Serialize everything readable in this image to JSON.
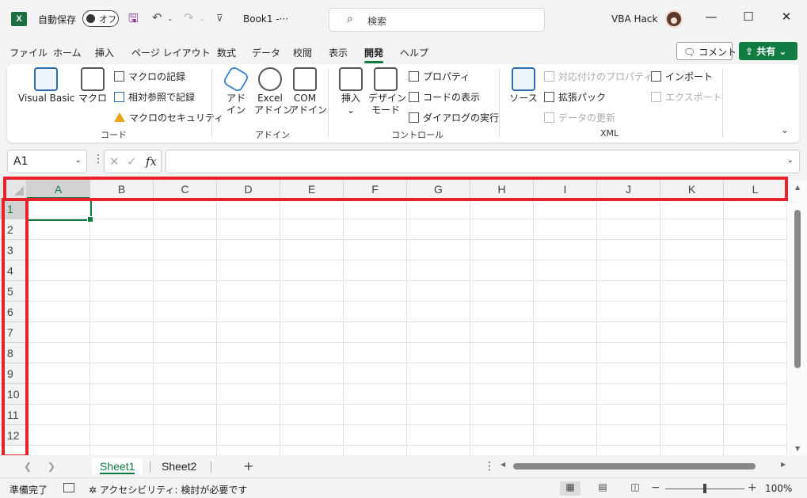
{
  "titlebar": {
    "app_logo": "X",
    "autosave_label": "自動保存",
    "autosave_state": "オフ",
    "document_title": "Book1  -···",
    "search_placeholder": "検索",
    "username": "VBA Hack",
    "icons": [
      "save-icon",
      "undo-icon",
      "redo-icon",
      "customize-qat-icon",
      "search-icon",
      "minimize-icon",
      "maximize-icon",
      "close-icon"
    ]
  },
  "menu": {
    "tabs": [
      "ファイル",
      "ホーム",
      "挿入",
      "ページ レイアウト",
      "数式",
      "データ",
      "校閲",
      "表示",
      "開発",
      "ヘルプ"
    ],
    "active_tab": "開発",
    "comment_label": "コメント",
    "share_label": "共有"
  },
  "ribbon": {
    "groups": [
      {
        "label": "コード",
        "big": [
          "Visual Basic",
          "マクロ"
        ],
        "small": [
          "マクロの記録",
          "相対参照で記録",
          "マクロのセキュリティ"
        ]
      },
      {
        "label": "アドイン",
        "big": [
          [
            "アド",
            "イン"
          ],
          [
            "Excel",
            "アドイン"
          ],
          [
            "COM",
            "アドイン"
          ]
        ]
      },
      {
        "label": "コントロール",
        "big": [
          [
            "挿入",
            "⌄"
          ],
          [
            "デザイン",
            "モード"
          ]
        ],
        "small": [
          "プロパティ",
          "コードの表示",
          "ダイアログの実行"
        ]
      },
      {
        "label": "XML",
        "big": [
          "ソース"
        ],
        "small": [
          "対応付けのプロパティ",
          "拡張パック",
          "データの更新",
          "インポート",
          "エクスポート"
        ]
      }
    ]
  },
  "formula_bar": {
    "name_box": "A1",
    "fx_label": "fx",
    "formula_value": ""
  },
  "grid": {
    "columns": [
      "A",
      "B",
      "C",
      "D",
      "E",
      "F",
      "G",
      "H",
      "I",
      "J",
      "K",
      "L"
    ],
    "rows": [
      "1",
      "2",
      "3",
      "4",
      "5",
      "6",
      "7",
      "8",
      "9",
      "10",
      "11",
      "12"
    ],
    "selected_cell": "A1"
  },
  "sheets": {
    "tabs": [
      "Sheet1",
      "Sheet2"
    ],
    "active": "Sheet1"
  },
  "statusbar": {
    "ready": "準備完了",
    "accessibility": "アクセシビリティ: 検討が必要です",
    "zoom": "100%"
  },
  "colors": {
    "accent": "#107c41",
    "highlight": "#e8212b"
  }
}
